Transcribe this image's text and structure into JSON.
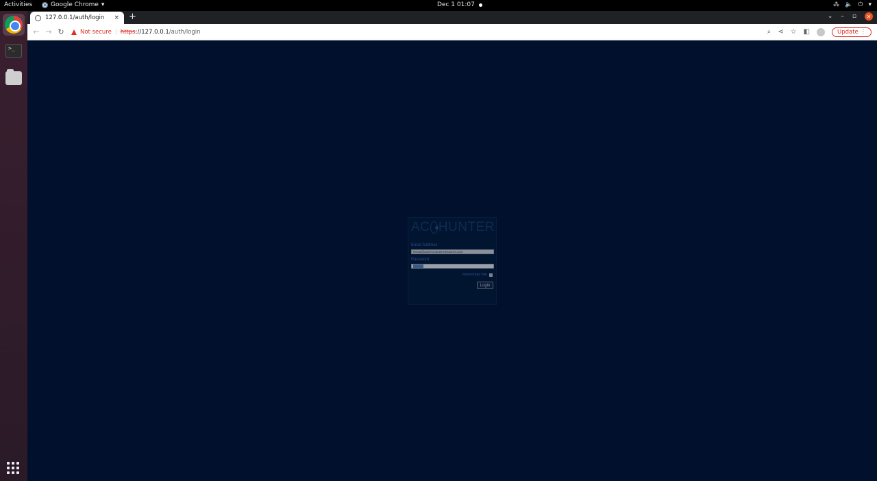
{
  "topbar": {
    "activities": "Activities",
    "app_name": "Google Chrome",
    "clock": "Dec 1  01:07",
    "tray": [
      "network-icon",
      "volume-icon",
      "power-icon"
    ]
  },
  "dock": {
    "items": [
      "chrome-icon",
      "terminal-icon",
      "files-icon"
    ],
    "show_apps": "apps-grid-icon"
  },
  "browser": {
    "tab_title": "127.0.0.1/auth/login",
    "tab_close": "×",
    "new_tab": "+",
    "security_label": "Not secure",
    "url_scheme": "https",
    "url_host": "://127.0.0.1",
    "url_path": "/auth/login",
    "update_label": "Update",
    "accent_color": "#d93025"
  },
  "login": {
    "logo_left": "AC",
    "logo_right": "HUNTER",
    "email_label": "Email Address",
    "email_value": "threat@activecountermeasures.com",
    "password_label": "Password",
    "remember_label": "Remember Me",
    "login_button": "Login",
    "background_color": "#01102c"
  }
}
